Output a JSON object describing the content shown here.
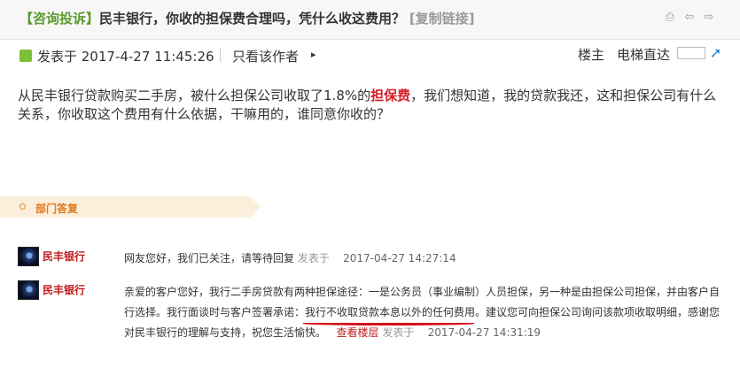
{
  "topbar": {
    "tag": "【咨询投诉】",
    "title": "民丰银行，你收的担保费合理吗，凭什么收这费用？",
    "copy_link": "[复制链接]",
    "icons": [
      "print-icon",
      "prev-icon",
      "next-icon"
    ]
  },
  "meta": {
    "posted_at": "发表于 2017-4-27 11:45:26",
    "separator": "|",
    "author_only": "只看该作者",
    "arrow": "▸",
    "owner": "楼主",
    "elevator": "电梯直达"
  },
  "post": {
    "part1": "从民丰银行贷款购买二手房，被什么担保公司收取了1.8%的",
    "highlight": "担保费",
    "part2": "，我们想知道，我的贷款我还，这和担保公司有什么关系，你收取这个费用有什么依据，干嘛用的，谁同意你收的？"
  },
  "section": {
    "label": "部门答复"
  },
  "replies": [
    {
      "name": "民丰银行",
      "text": "网友您好，我们已关注，请等待回复",
      "posted": "发表于",
      "time": "2017-04-27 14:27:14"
    },
    {
      "name": "民丰银行",
      "text1": "亲爱的客户您好，我行二手房贷款有两种担保途径：一是公务员（事业编制）人员担保，另一种是由担保公司担保，并由客户自行选择。我行面谈时与客户签署承诺：我行不收取贷款本息以外的任何费用。建议您可向担保公司询问该款项收取明细，感谢您对民丰银行的理解与支持，祝您生活愉快。",
      "view_floor": "查看楼层",
      "posted": "发表于",
      "time": "2017-04-27 14:31:19"
    }
  ],
  "colors": {
    "tag": "#5a9a2f",
    "highlight": "#d6202a",
    "dept_label": "#e07a1f",
    "bank_name": "#c01a1a",
    "annotation_line": "#d6101a"
  }
}
